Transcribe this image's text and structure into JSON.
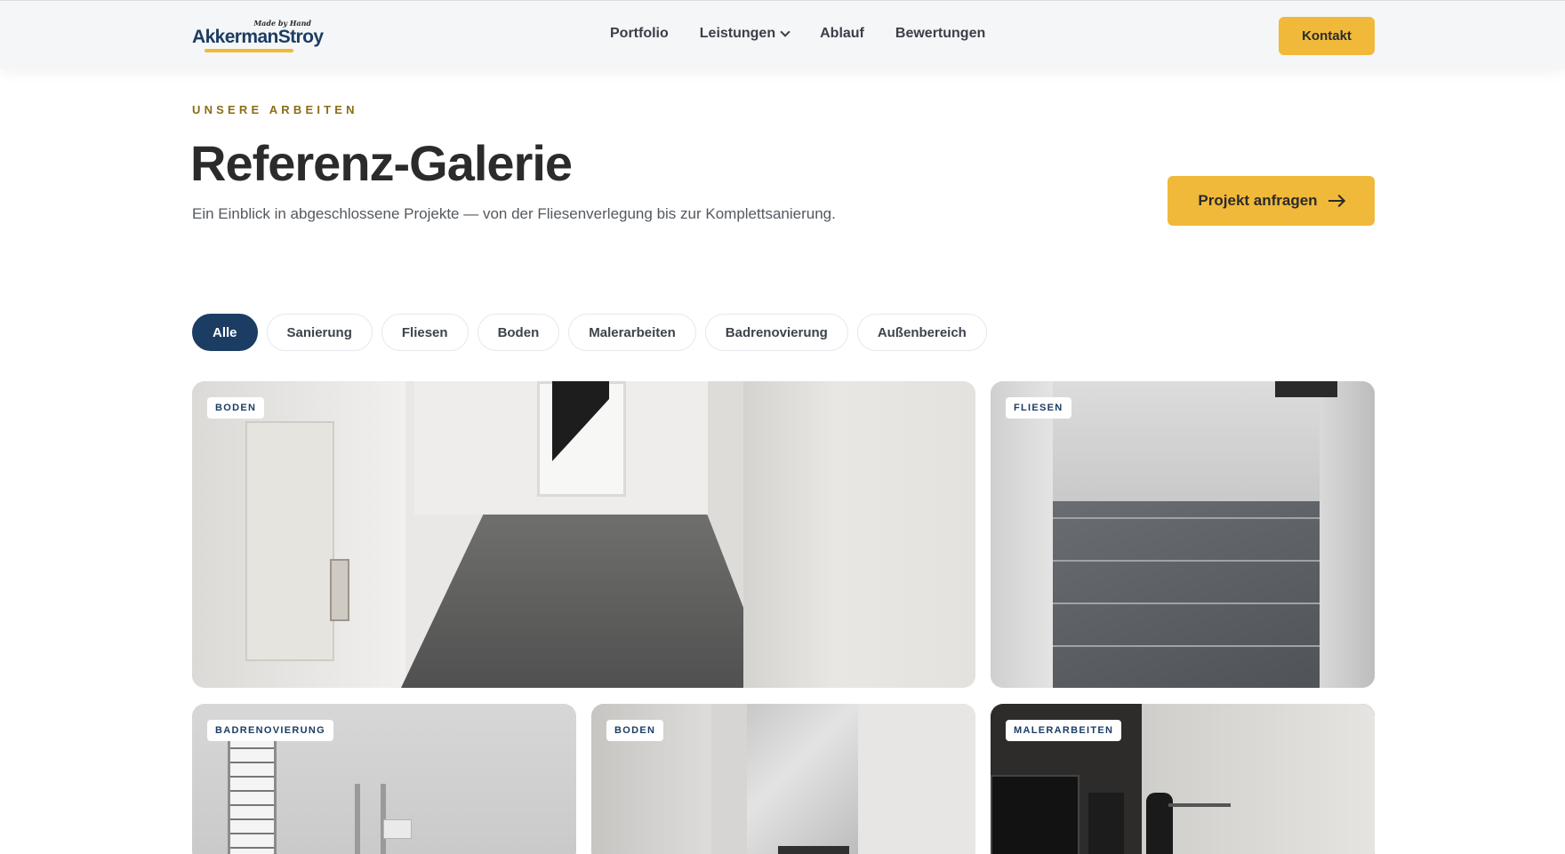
{
  "header": {
    "logo_text": "AkkermanStroy",
    "logo_tagline": "Made by Hand",
    "nav": [
      {
        "label": "Portfolio"
      },
      {
        "label": "Leistungen"
      },
      {
        "label": "Ablauf"
      },
      {
        "label": "Bewertungen"
      }
    ],
    "contact_button": "Kontakt"
  },
  "hero": {
    "eyebrow": "UNSERE ARBEITEN",
    "title": "Referenz-Galerie",
    "subtitle": "Ein Einblick in abgeschlossene Projekte — von der Fliesenverlegung bis zur Komplettsanierung.",
    "cta_label": "Projekt anfragen"
  },
  "filters": [
    {
      "label": "Alle",
      "active": true
    },
    {
      "label": "Sanierung",
      "active": false
    },
    {
      "label": "Fliesen",
      "active": false
    },
    {
      "label": "Boden",
      "active": false
    },
    {
      "label": "Malerarbeiten",
      "active": false
    },
    {
      "label": "Badrenovierung",
      "active": false
    },
    {
      "label": "Außenbereich",
      "active": false
    }
  ],
  "gallery": [
    {
      "category": "BODEN"
    },
    {
      "category": "FLIESEN"
    },
    {
      "category": "BADRENOVIERUNG"
    },
    {
      "category": "BODEN"
    },
    {
      "category": "MALERARBEITEN"
    }
  ],
  "colors": {
    "accent": "#f0b93a",
    "brand_navy": "#1b3d63",
    "eyebrow_gold": "#8a6d16"
  }
}
